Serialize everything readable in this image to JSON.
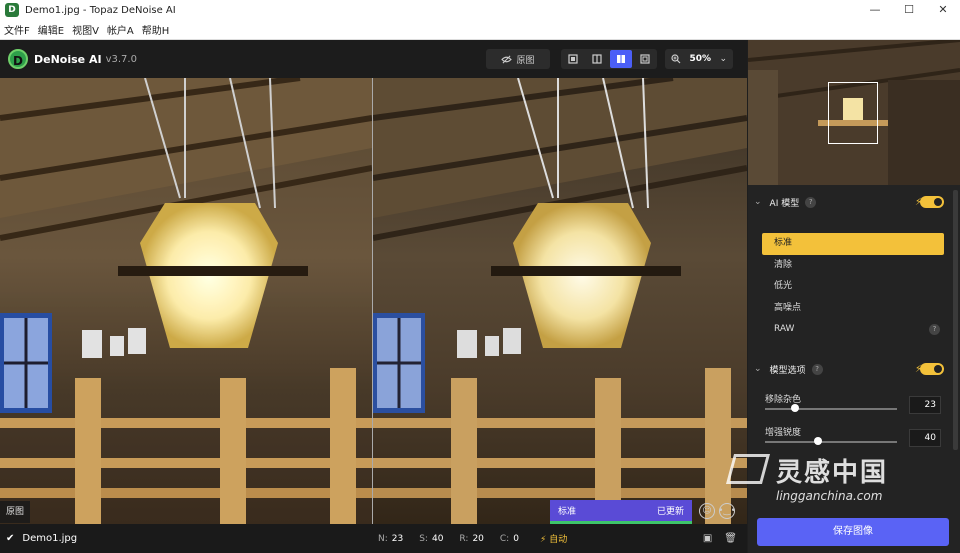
{
  "window": {
    "title": "Demo1.jpg - Topaz DeNoise AI",
    "minimize": "—",
    "maximize": "☐",
    "close": "✕"
  },
  "menu": [
    "文件F",
    "编辑E",
    "视图V",
    "帐户A",
    "帮助H"
  ],
  "toolbar": {
    "logo_letter": "D",
    "brand": "DeNoise AI",
    "version": "v3.7.0",
    "original_label": "原图",
    "zoom_value": "50%"
  },
  "viewer": {
    "original_tag": "原图",
    "status_model": "标准",
    "status_state": "已更新"
  },
  "bottombar": {
    "filename": "Demo1.jpg",
    "n_label": "N:",
    "n_value": "23",
    "s_label": "S:",
    "s_value": "40",
    "r_label": "R:",
    "r_value": "20",
    "c_label": "C:",
    "c_value": "0",
    "auto": "自动"
  },
  "panel": {
    "ai_model_title": "AI 模型",
    "models": [
      "标准",
      "清除",
      "低光",
      "高噪点",
      "RAW"
    ],
    "active_model_index": 0,
    "options_title": "模型选项",
    "sliders": [
      {
        "label": "移除杂色",
        "value": "23",
        "fraction": 0.23
      },
      {
        "label": "增强锐度",
        "value": "40",
        "fraction": 0.4
      }
    ],
    "save_label": "保存图像"
  },
  "watermark": {
    "cn": "灵感中国",
    "en": "lingganchina.com"
  },
  "colors": {
    "accent": "#f3c13a",
    "primary": "#5a63f5",
    "active_view": "#4b5ff7"
  }
}
